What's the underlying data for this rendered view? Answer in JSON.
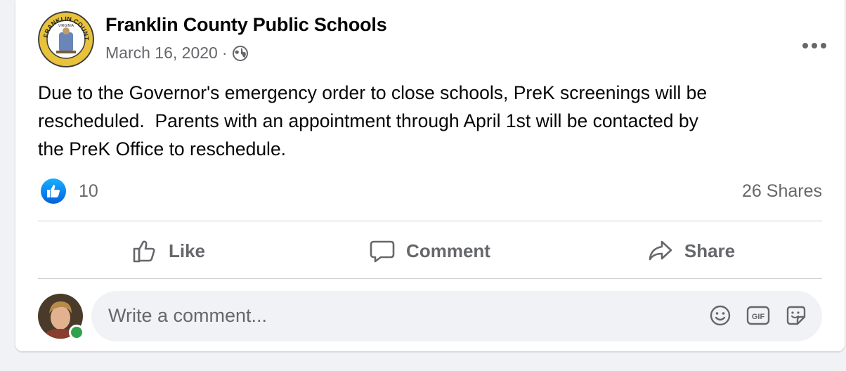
{
  "post": {
    "page_name": "Franklin County Public Schools",
    "date": "March 16, 2020",
    "separator": "·",
    "privacy_icon": "globe-icon",
    "logo": {
      "ring_text": "FRANKLIN COUNTY SCHOOLS",
      "inner_text": "VIRGINIA"
    },
    "message": "Due to the Governor's emergency order to close schools, PreK screenings will be\nrescheduled.  Parents with an appointment through April 1st will be contacted by\nthe PreK Office to reschedule.",
    "reaction_count": "10",
    "shares": "26 Shares",
    "colors": {
      "accent": "#1877f2",
      "muted": "#65676b",
      "online": "#31a24c"
    }
  },
  "actions": {
    "like": "Like",
    "comment": "Comment",
    "share": "Share"
  },
  "composer": {
    "placeholder": "Write a comment...",
    "tools": [
      "emoji-icon",
      "gif-icon",
      "sticker-icon"
    ]
  }
}
